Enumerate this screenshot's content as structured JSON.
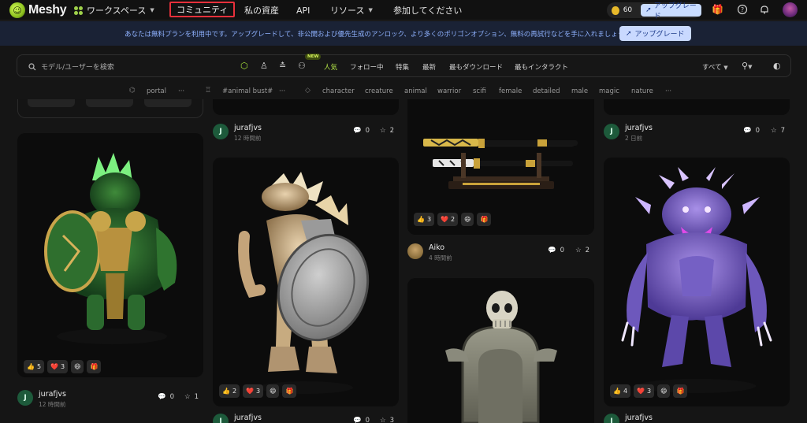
{
  "app": {
    "name": "Meshy"
  },
  "topnav": {
    "workspace_label": "ワークスペース",
    "community_label": "コミュニティ",
    "assets_label": "私の資産",
    "api_label": "API",
    "resources_label": "リソース",
    "join_label": "参加してください",
    "credits": "60",
    "upgrade_label": "アップグレード"
  },
  "banner": {
    "text": "あなたは無料プランを利用中です。アップグレードして、非公開および優先生成のアンロック、より多くのポリゴンオプション、無料の再試行などを手に入れましょう！",
    "button_label": "アップグレード"
  },
  "filterbar": {
    "search_placeholder": "モデル/ユーザーを検索",
    "new_badge": "NEW",
    "tabs": [
      "人気",
      "フォロー中",
      "特集",
      "最新",
      "最もダウンロード",
      "最もインタラクト"
    ],
    "active_tab": "人気",
    "all_label": "すべて"
  },
  "tags": {
    "group1": "portal",
    "group2": "#animal bust#",
    "items": [
      "character",
      "creature",
      "animal",
      "warrior",
      "scifi",
      "female",
      "detailed",
      "male",
      "magic",
      "nature"
    ],
    "more": "···"
  },
  "cards": {
    "col1_top": {
      "user": "",
      "time": ""
    },
    "green_beast": {
      "reactions": {
        "like": "5",
        "heart": "3"
      },
      "user": "jurafjvs",
      "avatar_letter": "J",
      "time": "12 時間前",
      "comments": "0",
      "stars": "1"
    },
    "col2_top": {
      "user": "jurafjvs",
      "avatar_letter": "J",
      "time": "12 時間前",
      "comments": "0",
      "stars": "2"
    },
    "dragon_warrior": {
      "reactions": {
        "like": "2",
        "heart": "3"
      },
      "user": "jurafjvs",
      "avatar_letter": "J",
      "comments": "0",
      "stars": "3"
    },
    "katana": {
      "reactions": {
        "like": "3",
        "heart": "2"
      },
      "user": "Aiko",
      "time": "4 時間前",
      "comments": "0",
      "stars": "2"
    },
    "col4_top": {
      "user": "jurafjvs",
      "avatar_letter": "J",
      "time": "2 日前",
      "comments": "0",
      "stars": "7"
    },
    "purple_demon": {
      "reactions": {
        "like": "4",
        "heart": "3"
      },
      "user": "jurafjvs",
      "avatar_letter": "J"
    }
  }
}
